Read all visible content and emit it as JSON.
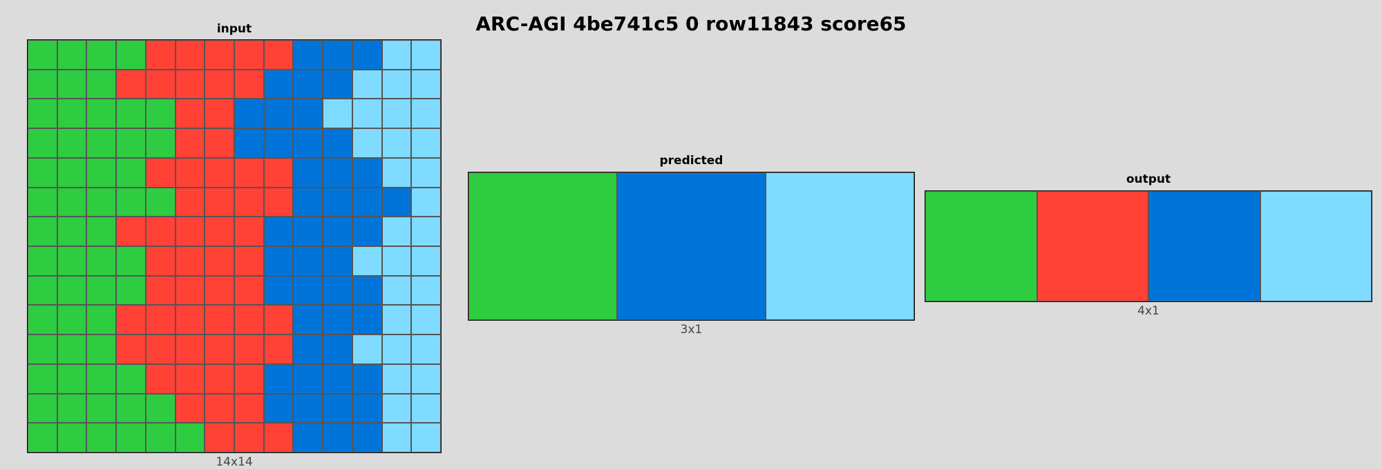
{
  "title": "ARC-AGI 4be741c5 0 row11843 score65",
  "palette": {
    "3": "#2ecc40",
    "2": "#ff4136",
    "1": "#0074d9",
    "8": "#7fdbff"
  },
  "panels": {
    "input": {
      "title": "input",
      "caption": "14x14",
      "grid": [
        [
          3,
          3,
          3,
          3,
          2,
          2,
          2,
          2,
          2,
          1,
          1,
          1,
          8,
          8
        ],
        [
          3,
          3,
          3,
          2,
          2,
          2,
          2,
          2,
          1,
          1,
          1,
          8,
          8,
          8
        ],
        [
          3,
          3,
          3,
          3,
          3,
          2,
          2,
          1,
          1,
          1,
          8,
          8,
          8,
          8
        ],
        [
          3,
          3,
          3,
          3,
          3,
          2,
          2,
          1,
          1,
          1,
          1,
          8,
          8,
          8
        ],
        [
          3,
          3,
          3,
          3,
          2,
          2,
          2,
          2,
          2,
          1,
          1,
          1,
          8,
          8
        ],
        [
          3,
          3,
          3,
          3,
          3,
          2,
          2,
          2,
          2,
          1,
          1,
          1,
          1,
          8
        ],
        [
          3,
          3,
          3,
          2,
          2,
          2,
          2,
          2,
          1,
          1,
          1,
          1,
          8,
          8
        ],
        [
          3,
          3,
          3,
          3,
          2,
          2,
          2,
          2,
          1,
          1,
          1,
          8,
          8,
          8
        ],
        [
          3,
          3,
          3,
          3,
          2,
          2,
          2,
          2,
          1,
          1,
          1,
          1,
          8,
          8
        ],
        [
          3,
          3,
          3,
          2,
          2,
          2,
          2,
          2,
          2,
          1,
          1,
          1,
          8,
          8
        ],
        [
          3,
          3,
          3,
          2,
          2,
          2,
          2,
          2,
          2,
          1,
          1,
          8,
          8,
          8
        ],
        [
          3,
          3,
          3,
          3,
          2,
          2,
          2,
          2,
          1,
          1,
          1,
          1,
          8,
          8
        ],
        [
          3,
          3,
          3,
          3,
          3,
          2,
          2,
          2,
          1,
          1,
          1,
          1,
          8,
          8
        ],
        [
          3,
          3,
          3,
          3,
          3,
          3,
          2,
          2,
          2,
          1,
          1,
          1,
          8,
          8
        ]
      ]
    },
    "predicted": {
      "title": "predicted",
      "caption": "3x1",
      "grid": [
        [
          3,
          1,
          8
        ]
      ]
    },
    "output": {
      "title": "output",
      "caption": "4x1",
      "grid": [
        [
          3,
          2,
          1,
          8
        ]
      ]
    }
  }
}
